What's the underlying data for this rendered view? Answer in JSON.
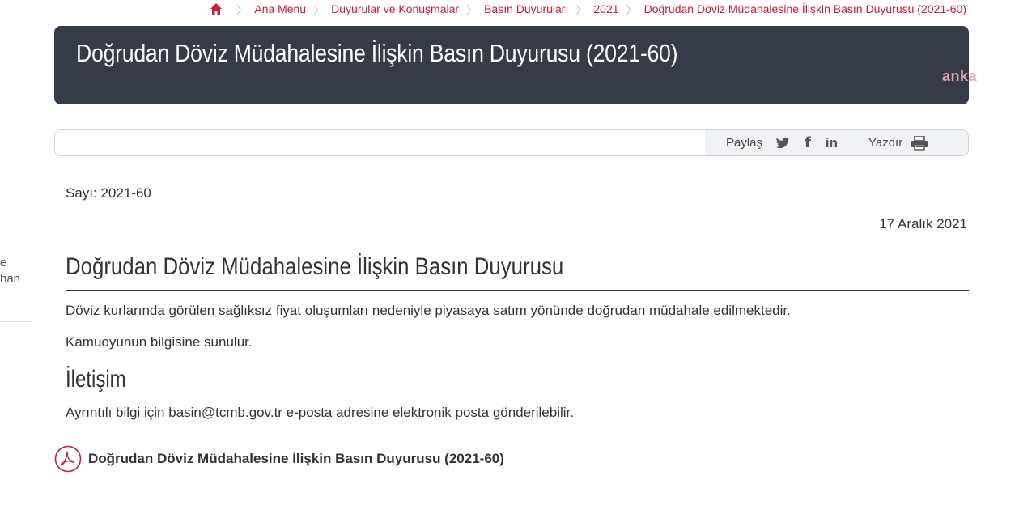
{
  "breadcrumb": {
    "items": [
      "Ana Menü",
      "Duyurular ve Konuşmalar",
      "Basın Duyuruları",
      "2021",
      "Doğrudan Döviz Müdahalesine İlişkin Basın Duyurusu (2021-60)"
    ]
  },
  "banner": {
    "title": "Doğrudan Döviz Müdahalesine İlişkin Basın Duyurusu (2021-60)",
    "watermark": "anka"
  },
  "share_bar": {
    "share_label": "Paylaş",
    "print_label": "Yazdır",
    "icons": [
      "twitter-icon",
      "facebook-icon",
      "linkedin-icon",
      "printer-icon"
    ]
  },
  "meta": {
    "issue_number": "Sayı: 2021-60",
    "date": "17 Aralık 2021"
  },
  "content": {
    "heading": "Doğrudan Döviz Müdahalesine İlişkin Basın Duyurusu",
    "paragraph1": "Döviz kurlarında görülen sağlıksız fiyat oluşumları nedeniyle piyasaya satım yönünde doğrudan müdahale edilmektedir.",
    "paragraph2": "Kamuoyunun bilgisine sunulur.",
    "contact_heading": "İletişim",
    "contact_text": "Ayrıntılı bilgi için basin@tcmb.gov.tr e-posta adresine elektronik posta gönderilebilir.",
    "pdf_link": "Doğrudan Döviz Müdahalesine İlişkin Basın Duyurusu (2021-60)"
  },
  "left_fragment": {
    "line1": "e",
    "line2": "han"
  },
  "colors": {
    "accent": "#c41e3a",
    "banner_bg": "#363c47",
    "text": "#333333"
  }
}
